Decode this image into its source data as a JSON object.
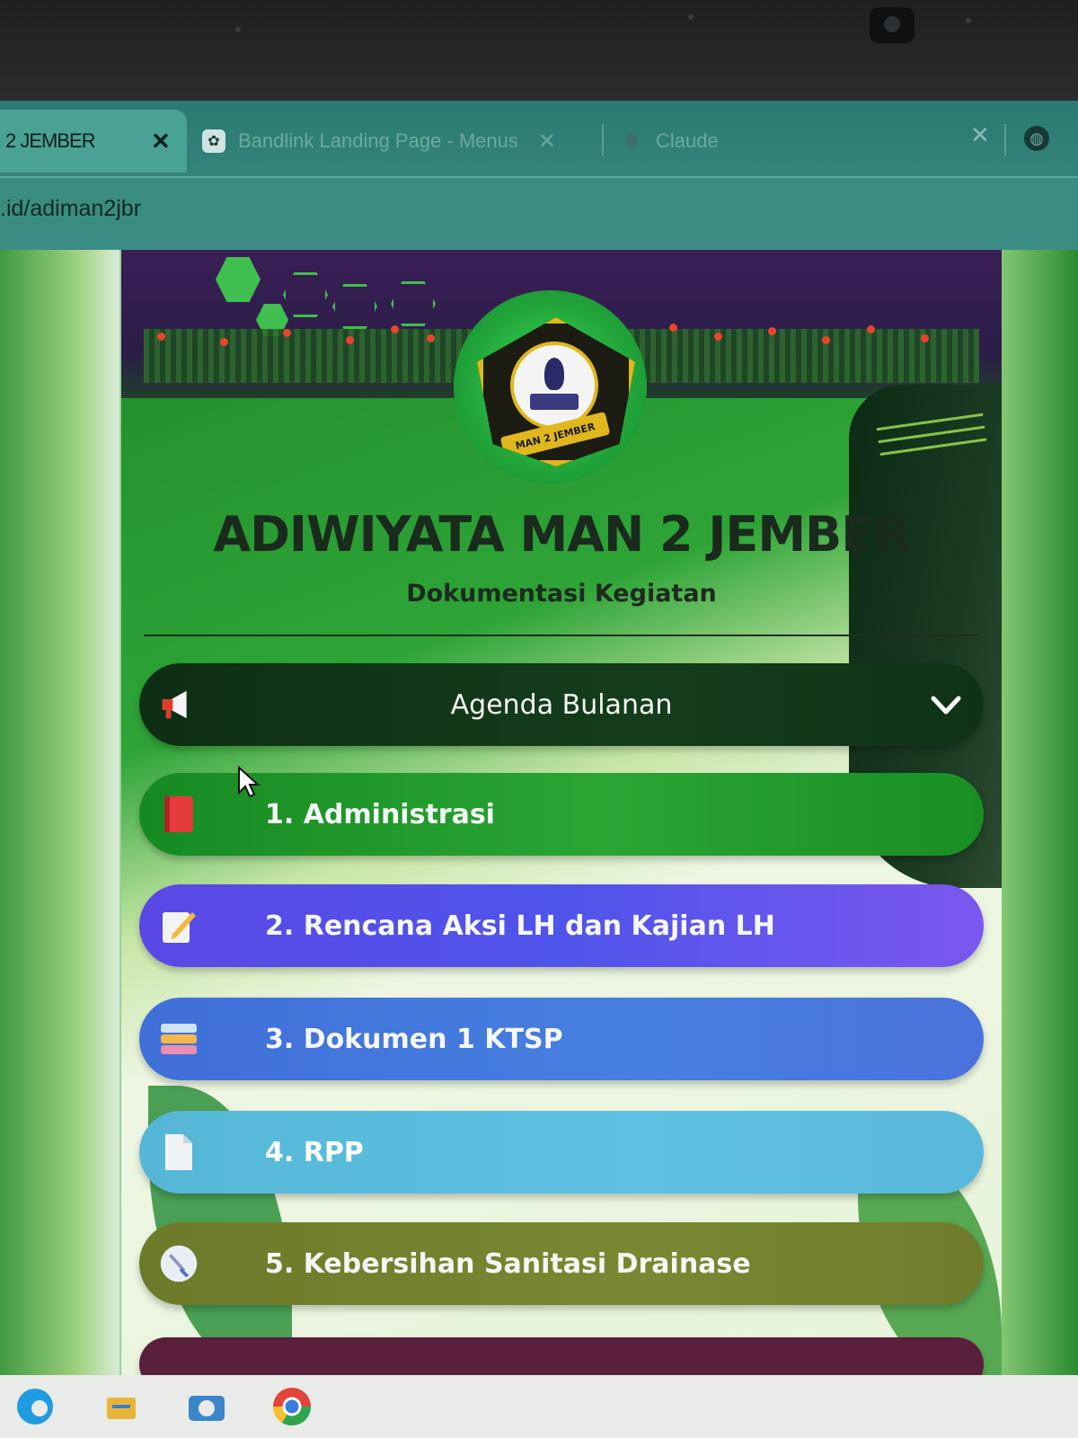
{
  "browser": {
    "tabs": [
      {
        "label": "2 JEMBER",
        "active": true,
        "close": "✕"
      },
      {
        "label": "Bandlink Landing Page - Menus",
        "active": false,
        "close": "✕",
        "icon": "bandlink-icon"
      },
      {
        "label": "Claude",
        "active": false,
        "close": "✕",
        "icon": "claude-icon"
      }
    ],
    "address": ".id/adiman2jbr"
  },
  "page": {
    "logo_ribbon": "MAN 2 JEMBER",
    "title": "ADIWIYATA MAN 2 JEMBER",
    "subtitle": "Dokumentasi Kegiatan",
    "agenda": {
      "label": "Agenda Bulanan",
      "icon": "megaphone-icon",
      "chevron": "chevron-down-icon"
    },
    "menu": [
      {
        "label": "1. Administrasi",
        "icon": "book-icon",
        "color": "#22a02e"
      },
      {
        "label": "2. Rencana Aksi LH dan Kajian LH",
        "icon": "memo-icon",
        "color": "#5a50e8"
      },
      {
        "label": "3. Dokumen 1 KTSP",
        "icon": "books-stack-icon",
        "color": "#4478de"
      },
      {
        "label": "4. RPP",
        "icon": "page-icon",
        "color": "#5cbfdf"
      },
      {
        "label": "5. Kebersihan Sanitasi Drainase",
        "icon": "broom-icon",
        "color": "#74822f"
      }
    ]
  },
  "colors": {
    "accent": "#2ea437",
    "chrome": "#3a8c82",
    "dark_green": "#143d1b"
  }
}
